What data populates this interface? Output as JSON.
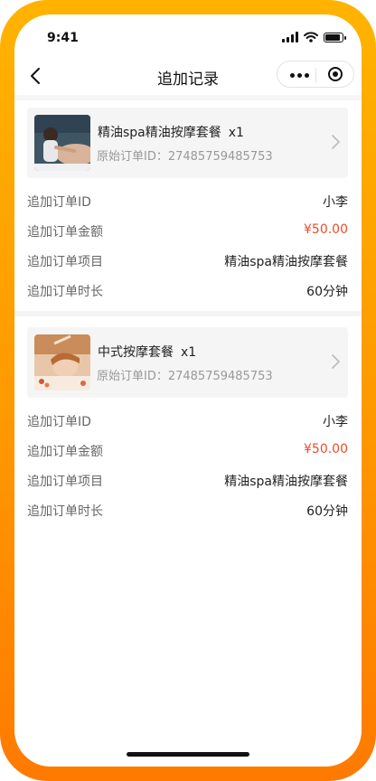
{
  "status_bar": {
    "time": "9:41"
  },
  "nav": {
    "title": "追加记录"
  },
  "records": [
    {
      "product": {
        "name": "精油spa精油按摩套餐",
        "qty": "x1",
        "original_order": "原始订单ID：27485759485753"
      },
      "rows": [
        {
          "label": "追加订单ID",
          "value": "小李"
        },
        {
          "label": "追加订单金额",
          "value": "¥50.00"
        },
        {
          "label": "追加订单项目",
          "value": "精油spa精油按摩套餐"
        },
        {
          "label": "追加订单时长",
          "value": "60分钟"
        }
      ]
    },
    {
      "product": {
        "name": "中式按摩套餐",
        "qty": "x1",
        "original_order": "原始订单ID：27485759485753"
      },
      "rows": [
        {
          "label": "追加订单ID",
          "value": "小李"
        },
        {
          "label": "追加订单金额",
          "value": "¥50.00"
        },
        {
          "label": "追加订单项目",
          "value": "精油spa精油按摩套餐"
        },
        {
          "label": "追加订单时长",
          "value": "60分钟"
        }
      ]
    }
  ],
  "colors": {
    "frame": "#ff9800",
    "price": "#e94e2b",
    "card_bg": "#f5f5f5"
  },
  "icons": [
    "back-arrow-icon",
    "more-dots-icon",
    "target-circle-icon",
    "chevron-right-icon",
    "signal-icon",
    "wifi-icon",
    "battery-icon"
  ]
}
